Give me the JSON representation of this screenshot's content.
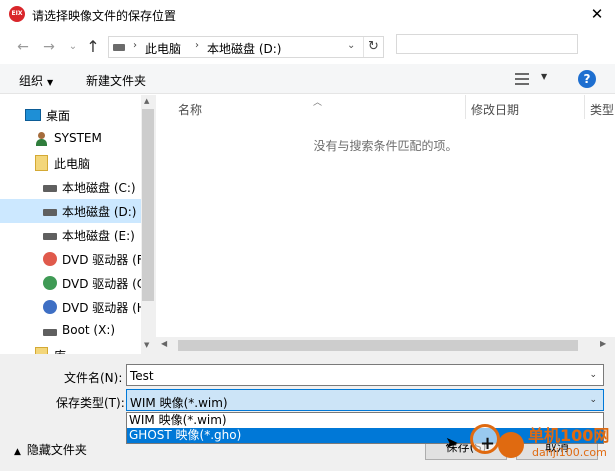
{
  "window": {
    "app_icon_text": "EIX",
    "title": "请选择映像文件的保存位置",
    "close_glyph": "✕"
  },
  "nav": {
    "back_icon": "←",
    "forward_icon": "→",
    "recent_icon": "⌄",
    "up_icon": "↑",
    "breadcrumb": [
      "此电脑",
      "本地磁盘 (D:)"
    ],
    "refresh_icon": "↻",
    "search_placeholder": ""
  },
  "toolbar": {
    "organize": "组织",
    "new_folder": "新建文件夹",
    "help": "?"
  },
  "sidebar": {
    "items": [
      {
        "label": "桌面",
        "icon": "desktop-icon"
      },
      {
        "label": "SYSTEM",
        "icon": "user-icon"
      },
      {
        "label": "此电脑",
        "icon": "folder-icon"
      },
      {
        "label": "本地磁盘 (C:)",
        "icon": "drive-icon"
      },
      {
        "label": "本地磁盘 (D:)",
        "icon": "drive-icon",
        "selected": true
      },
      {
        "label": "本地磁盘 (E:)",
        "icon": "drive-icon"
      },
      {
        "label": "DVD 驱动器 (F",
        "icon": "dvd-icon"
      },
      {
        "label": "DVD 驱动器 (C",
        "icon": "dvd-icon"
      },
      {
        "label": "DVD 驱动器 (H",
        "icon": "dvd-icon"
      },
      {
        "label": "Boot (X:)",
        "icon": "drive-icon"
      },
      {
        "label": "库",
        "icon": "folder-icon"
      }
    ]
  },
  "content": {
    "columns": [
      "名称",
      "修改日期",
      "类型"
    ],
    "empty_message": "没有与搜索条件匹配的项。"
  },
  "form": {
    "filename_label": "文件名(N):",
    "filename_value": "Test",
    "filetype_label": "保存类型(T):",
    "filetype_value": "WIM 映像(*.wim)",
    "options": [
      "WIM 映像(*.wim)",
      "GHOST 映像(*.gho)"
    ],
    "highlighted_option": 1
  },
  "footer": {
    "hide_folders": "隐藏文件夹",
    "save": "保存(S)",
    "cancel": "取消"
  },
  "watermark": {
    "text": "单机100网",
    "sub": "danji100.com"
  },
  "colors": {
    "accent": "#0078d7",
    "selection": "#cce8ff",
    "watermark": "#e06a10"
  }
}
